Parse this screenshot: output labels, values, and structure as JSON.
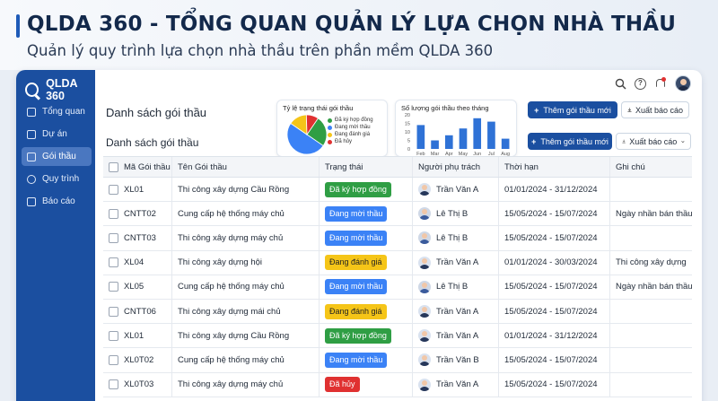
{
  "banner": {
    "title": "QLDA 360 - TỔNG QUAN QUẢN LÝ LỰA CHỌN NHÀ THẦU",
    "subtitle": "Quản lý quy trình lựa chọn nhà thầu trên phần mềm QLDA 360"
  },
  "app": {
    "logo": "QLDA 360",
    "nav": [
      {
        "label": "Tổng quan",
        "icon": "home-icon",
        "active": false
      },
      {
        "label": "Dự án",
        "icon": "folder-icon",
        "active": false
      },
      {
        "label": "Gói thầu",
        "icon": "package-icon",
        "active": true
      },
      {
        "label": "Quy trình",
        "icon": "workflow-icon",
        "active": false
      },
      {
        "label": "Báo cáo",
        "icon": "report-icon",
        "active": false
      }
    ],
    "topbar_icons": [
      "search-icon",
      "help-icon",
      "bell-icon",
      "user-avatar"
    ]
  },
  "main": {
    "page_title": "Danh sách gói thầu",
    "section_title": "Danh sách gói thầu",
    "buttons": {
      "add_top": "Thêm gói thầu mới",
      "export_top": "Xuất báo cáo",
      "add": "Thêm gói thầu mới",
      "export": "Xuất báo cáo"
    },
    "pie_card": {
      "title": "Tỷ lệ trạng thái gói thầu",
      "legend": [
        {
          "label": "Đã ký hợp đồng",
          "color": "#2f9e44"
        },
        {
          "label": "Đang mời thầu",
          "color": "#3b82f6"
        },
        {
          "label": "Đang đánh giá",
          "color": "#f5c518"
        },
        {
          "label": "Đã hủy",
          "color": "#e03131"
        }
      ]
    },
    "bar_card": {
      "title": "Số lượng gói thầu theo tháng"
    },
    "table": {
      "headers": [
        "Mã Gói thầu",
        "Tên Gói thầu",
        "Trạng thái",
        "Người phụ trách",
        "Thời hạn",
        "Ghi chú"
      ],
      "rows": [
        {
          "code": "XL01",
          "name": "Thi công xây dựng Cầu Rồng",
          "status": "Đã ký hợp đồng",
          "status_color": "green",
          "person": "Trần Văn A",
          "gender": "m",
          "period": "01/01/2024 - 31/12/2024",
          "note": ""
        },
        {
          "code": "CNTT02",
          "name": "Cung cấp hệ thống máy chủ",
          "status": "Đang mời thầu",
          "status_color": "blue",
          "person": "Lê Thị B",
          "gender": "f",
          "period": "15/05/2024 - 15/07/2024",
          "note": "Ngày nhần bán thầu"
        },
        {
          "code": "CNTT03",
          "name": "Thi công xây dựng máy chủ",
          "status": "Đang mời thầu",
          "status_color": "blue",
          "person": "Lê Thị B",
          "gender": "f",
          "period": "15/05/2024 - 15/07/2024",
          "note": ""
        },
        {
          "code": "XL04",
          "name": "Thi công xây dựng hội",
          "status": "Đang đánh giá",
          "status_color": "yellow",
          "person": "Trần Văn A",
          "gender": "m",
          "period": "01/01/2024 - 30/03/2024",
          "note": "Thi công xây dựng"
        },
        {
          "code": "XL05",
          "name": "Cung cấp hệ thống máy chủ",
          "status": "Đang mời thầu",
          "status_color": "blue",
          "person": "Lê Thị B",
          "gender": "f",
          "period": "15/05/2024 - 15/07/2024",
          "note": "Ngày nhần bán thầu"
        },
        {
          "code": "CNTT06",
          "name": "Thi công xây dựng mái chủ",
          "status": "Đang đánh giá",
          "status_color": "yellow",
          "person": "Trần Văn A",
          "gender": "m",
          "period": "15/05/2024 - 15/07/2024",
          "note": ""
        },
        {
          "code": "XL01",
          "name": "Thi công xây dựng Cầu Rồng",
          "status": "Đã ký hợp đồng",
          "status_color": "green",
          "person": "Trần Văn A",
          "gender": "m",
          "period": "01/01/2024 - 31/12/2024",
          "note": ""
        },
        {
          "code": "XL0T02",
          "name": "Cung cấp hệ thống máy chủ",
          "status": "Đang mời thầu",
          "status_color": "blue",
          "person": "Trần Văn B",
          "gender": "m",
          "period": "15/05/2024 - 15/07/2024",
          "note": ""
        },
        {
          "code": "XL0T03",
          "name": "Thi công xây dựng máy chủ",
          "status": "Đã hủy",
          "status_color": "red",
          "person": "Trần Văn A",
          "gender": "m",
          "period": "15/05/2024 - 15/07/2024",
          "note": ""
        }
      ]
    }
  },
  "chart_data": [
    {
      "type": "pie",
      "title": "Tỷ lệ trạng thái gói thầu",
      "categories": [
        "Đã ký hợp đồng",
        "Đang mời thầu",
        "Đang đánh giá",
        "Đã hủy"
      ],
      "values": [
        25,
        50,
        15,
        10
      ],
      "colors": [
        "#2f9e44",
        "#3b82f6",
        "#f5c518",
        "#e03131"
      ]
    },
    {
      "type": "bar",
      "title": "Số lượng gói thầu theo tháng",
      "categories": [
        "Feb",
        "Mar",
        "Apr",
        "May",
        "Jun",
        "Jul",
        "Aug"
      ],
      "values": [
        14,
        5,
        8,
        12,
        18,
        16,
        6
      ],
      "ylim": [
        0,
        20
      ],
      "yticks": [
        0,
        5,
        10,
        15,
        20
      ],
      "color": "#2f72d6"
    }
  ]
}
